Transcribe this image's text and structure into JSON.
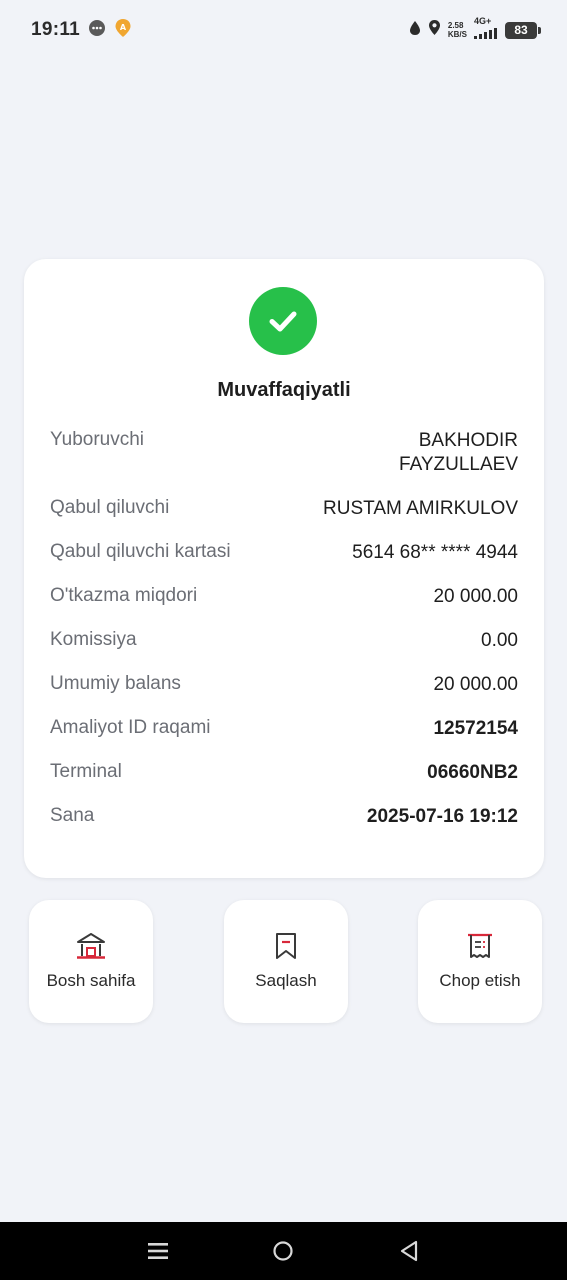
{
  "status_bar": {
    "time": "19:11",
    "speed_value": "2.58",
    "speed_unit": "KB/S",
    "network": "4G+",
    "battery": "83"
  },
  "receipt": {
    "title": "Muvaffaqiyatli",
    "rows": [
      {
        "label": "Yuboruvchi",
        "value": "BAKHODIR FAYZULLAEV"
      },
      {
        "label": "Qabul qiluvchi",
        "value": "RUSTAM AMIRKULOV"
      },
      {
        "label": "Qabul qiluvchi kartasi",
        "value": "5614 68** **** 4944"
      },
      {
        "label": "O'tkazma miqdori",
        "value": "20 000.00"
      },
      {
        "label": "Komissiya",
        "value": "0.00"
      },
      {
        "label": "Umumiy balans",
        "value": "20 000.00"
      },
      {
        "label": "Amaliyot ID raqami",
        "value": "12572154"
      },
      {
        "label": "Terminal",
        "value": "06660NB2"
      },
      {
        "label": "Sana",
        "value": "2025-07-16 19:12"
      }
    ]
  },
  "actions": {
    "home_label": "Bosh sahifa",
    "save_label": "Saqlash",
    "print_label": "Chop etish"
  },
  "colors": {
    "success": "#27c04a",
    "accent_red": "#d8283a",
    "background": "#f1f3f8"
  },
  "icons": {
    "home": "bank-icon",
    "save": "bookmark-icon",
    "print": "receipt-icon"
  }
}
